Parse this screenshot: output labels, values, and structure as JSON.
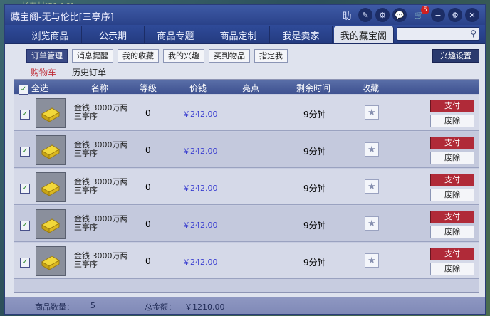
{
  "background": {
    "text": "长寿村[51,16]"
  },
  "window": {
    "title": "藏宝阁-无与伦比[三亭序]",
    "icons": [
      "help-icon",
      "pin-icon",
      "gear-icon",
      "chat-icon",
      "cart-icon",
      "minimize-icon",
      "settings-icon",
      "close-icon"
    ],
    "help_label": "助",
    "cart_badge": "5"
  },
  "tabs": [
    {
      "label": "浏览商品"
    },
    {
      "label": "公示期"
    },
    {
      "label": "商品专题"
    },
    {
      "label": "商品定制"
    },
    {
      "label": "我是卖家"
    },
    {
      "label": "我的藏宝阁",
      "active": true
    }
  ],
  "search": {
    "value": "",
    "placeholder": ""
  },
  "subtabs": [
    {
      "label": "订单管理",
      "active": true
    },
    {
      "label": "消息提醒"
    },
    {
      "label": "我的收藏"
    },
    {
      "label": "我的兴趣"
    },
    {
      "label": "买到物品"
    },
    {
      "label": "指定我"
    }
  ],
  "interest_button": "兴趣设置",
  "cart_tabs": [
    {
      "label": "购物车",
      "active": true
    },
    {
      "label": "历史订单"
    }
  ],
  "table": {
    "columns": [
      "全选",
      "名称",
      "等级",
      "价钱",
      "亮点",
      "剩余时间",
      "收藏"
    ],
    "rows": [
      {
        "name": "金钱 3000万两 三亭序",
        "level": "0",
        "price": "￥242.00",
        "remaining": "9分钟",
        "pay": "支付",
        "remove": "废除",
        "checked": true
      },
      {
        "name": "金钱 3000万两 三亭序",
        "level": "0",
        "price": "￥242.00",
        "remaining": "9分钟",
        "pay": "支付",
        "remove": "废除",
        "checked": true
      },
      {
        "name": "金钱 3000万两 三亭序",
        "level": "0",
        "price": "￥242.00",
        "remaining": "9分钟",
        "pay": "支付",
        "remove": "废除",
        "checked": true
      },
      {
        "name": "金钱 3000万两 三亭序",
        "level": "0",
        "price": "￥242.00",
        "remaining": "9分钟",
        "pay": "支付",
        "remove": "废除",
        "checked": true
      },
      {
        "name": "金钱 3000万两 三亭序",
        "level": "0",
        "price": "￥242.00",
        "remaining": "9分钟",
        "pay": "支付",
        "remove": "废除",
        "checked": true
      }
    ]
  },
  "footer": {
    "count_label": "商品数量：",
    "count_value": "5",
    "total_label": "总金额：",
    "total_value": "￥1210.00"
  }
}
